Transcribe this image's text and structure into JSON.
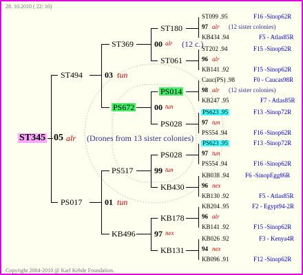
{
  "header": "28. 10.2010 ( 22: 10)",
  "footer": "Copyright 2004-2010 @ Karl Kehde Foundation.",
  "root": {
    "id": "ST345",
    "gen": "05",
    "race": "alr",
    "note": "(Drones from 13 sister colonies)"
  },
  "g1": [
    {
      "id": "ST494",
      "gen": "03",
      "race": "tun"
    },
    {
      "id": "PS017",
      "gen": "01",
      "race": "tun"
    }
  ],
  "g2": [
    {
      "id": "ST369",
      "gen": "00",
      "race": "alr",
      "note": "(12 c.)"
    },
    {
      "id": "PS672",
      "gen": "00",
      "race": "tun"
    },
    {
      "id": "PS517",
      "gen": "99",
      "race": "tun"
    },
    {
      "id": "KB496",
      "gen": "97",
      "race": "nex"
    }
  ],
  "g3": [
    "ST180",
    "ST061",
    "PS014",
    "PS028",
    "PS028",
    "KB430",
    "KB178",
    "KB131"
  ],
  "leaves": [
    {
      "a": "ST099 .95",
      "b": "F16 -Sinop62R"
    },
    {
      "gen": "97",
      "race": "alr",
      "note": "(12 sister colonies)"
    },
    {
      "a": "KB434 .94",
      "b": "F5 - Atlas85R"
    },
    {
      "a": "ST202 .94",
      "b": "F15 -Sinop62R"
    },
    {
      "gen": "96",
      "race": "alr"
    },
    {
      "a": "KB141 .92",
      "b": "F15 -Sinop62R"
    },
    {
      "a": "Cauc(PS) .98",
      "b": "F0 - Caucas98R"
    },
    {
      "gen": "98",
      "race": "alr",
      "note": "(12 sister colonies)"
    },
    {
      "a": "KB247 .95",
      "b": "F7 - Atlas85R"
    },
    {
      "a": "PS623 .95",
      "b": "F13 -Sinop72R"
    },
    {
      "gen": "97",
      "race": "tun"
    },
    {
      "a": "PS554 .94",
      "b": "F16 -Sinop62R"
    },
    {
      "a": "PS623 .95",
      "b": "F13 -Sinop72R"
    },
    {
      "gen": "97",
      "race": "tun"
    },
    {
      "a": "PS554 .94",
      "b": "F16 -Sinop62R"
    },
    {
      "a": "KB038 .94",
      "b": "F6 -SinopEgg86R"
    },
    {
      "gen": "96",
      "race": "nex"
    },
    {
      "a": "KB130 .92",
      "b": "F5 - Atlas85R"
    },
    {
      "a": "KB204 .95",
      "b": "F2 - Egypt94-2R"
    },
    {
      "gen": "96",
      "race": "alr"
    },
    {
      "a": "KB141 .92",
      "b": "F15 -Sinop62R"
    },
    {
      "a": "KB026 .92",
      "b": "F3 - Kenya4R"
    },
    {
      "gen": "94",
      "race": "nex"
    },
    {
      "a": "KB096 .91",
      "b": "F12 -Sinop62R"
    }
  ]
}
